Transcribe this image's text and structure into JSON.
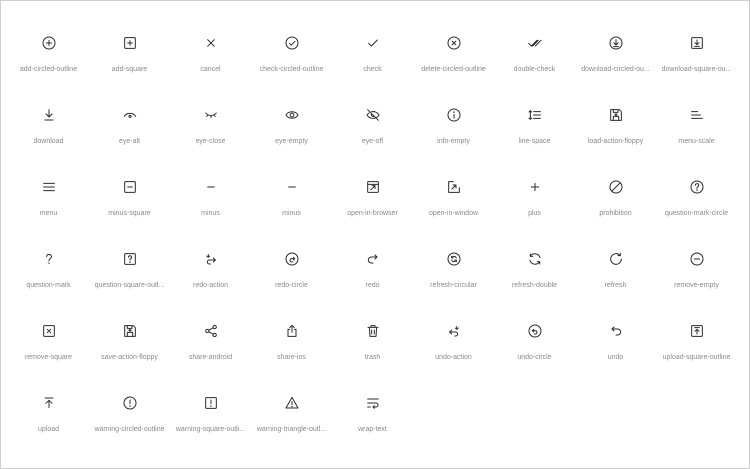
{
  "icons": [
    {
      "label": "add-circled-outline",
      "icon": "add-circled-outline-icon"
    },
    {
      "label": "add-square",
      "icon": "add-square-icon"
    },
    {
      "label": "cancel",
      "icon": "cancel-icon"
    },
    {
      "label": "check-circled-outline",
      "icon": "check-circled-outline-icon"
    },
    {
      "label": "check",
      "icon": "check-icon"
    },
    {
      "label": "delete-circled-outline",
      "icon": "delete-circled-outline-icon"
    },
    {
      "label": "double-check",
      "icon": "double-check-icon"
    },
    {
      "label": "download-circled-ou...",
      "icon": "download-circled-outline-icon"
    },
    {
      "label": "download-square-ou...",
      "icon": "download-square-outline-icon"
    },
    {
      "label": "download",
      "icon": "download-icon"
    },
    {
      "label": "eye-alt",
      "icon": "eye-alt-icon"
    },
    {
      "label": "eye-close",
      "icon": "eye-close-icon"
    },
    {
      "label": "eye-empty",
      "icon": "eye-empty-icon"
    },
    {
      "label": "eye-off",
      "icon": "eye-off-icon"
    },
    {
      "label": "info-empty",
      "icon": "info-empty-icon"
    },
    {
      "label": "line-space",
      "icon": "line-space-icon"
    },
    {
      "label": "load-action-floppy",
      "icon": "load-action-floppy-icon"
    },
    {
      "label": "menu-scale",
      "icon": "menu-scale-icon"
    },
    {
      "label": "menu",
      "icon": "menu-icon"
    },
    {
      "label": "minus-square",
      "icon": "minus-square-icon"
    },
    {
      "label": "minus",
      "icon": "minus-icon"
    },
    {
      "label": "minus",
      "icon": "minus-icon"
    },
    {
      "label": "open-in-browser",
      "icon": "open-in-browser-icon"
    },
    {
      "label": "open-in-window",
      "icon": "open-in-window-icon"
    },
    {
      "label": "plus",
      "icon": "plus-icon"
    },
    {
      "label": "prohibition",
      "icon": "prohibition-icon"
    },
    {
      "label": "question-mark-circle",
      "icon": "question-mark-circle-icon"
    },
    {
      "label": "question-mark",
      "icon": "question-mark-icon"
    },
    {
      "label": "question-square-outl...",
      "icon": "question-square-outline-icon"
    },
    {
      "label": "redo-action",
      "icon": "redo-action-icon"
    },
    {
      "label": "redo-circle",
      "icon": "redo-circle-icon"
    },
    {
      "label": "redo",
      "icon": "redo-icon"
    },
    {
      "label": "refresh-circular",
      "icon": "refresh-circular-icon"
    },
    {
      "label": "refresh-double",
      "icon": "refresh-double-icon"
    },
    {
      "label": "refresh",
      "icon": "refresh-icon"
    },
    {
      "label": "remove-empty",
      "icon": "remove-empty-icon"
    },
    {
      "label": "remove-square",
      "icon": "remove-square-icon"
    },
    {
      "label": "save-action-floppy",
      "icon": "save-action-floppy-icon"
    },
    {
      "label": "share-android",
      "icon": "share-android-icon"
    },
    {
      "label": "share-ios",
      "icon": "share-ios-icon"
    },
    {
      "label": "trash",
      "icon": "trash-icon"
    },
    {
      "label": "undo-action",
      "icon": "undo-action-icon"
    },
    {
      "label": "undo-circle",
      "icon": "undo-circle-icon"
    },
    {
      "label": "undo",
      "icon": "undo-icon"
    },
    {
      "label": "upload-square-outline",
      "icon": "upload-square-outline-icon"
    },
    {
      "label": "upload",
      "icon": "upload-icon"
    },
    {
      "label": "warning-circled-outline",
      "icon": "warning-circled-outline-icon"
    },
    {
      "label": "warning-square-outli...",
      "icon": "warning-square-outline-icon"
    },
    {
      "label": "warning-triangle-outl...",
      "icon": "warning-triangle-outline-icon"
    },
    {
      "label": "wrap-text",
      "icon": "wrap-text-icon"
    }
  ]
}
